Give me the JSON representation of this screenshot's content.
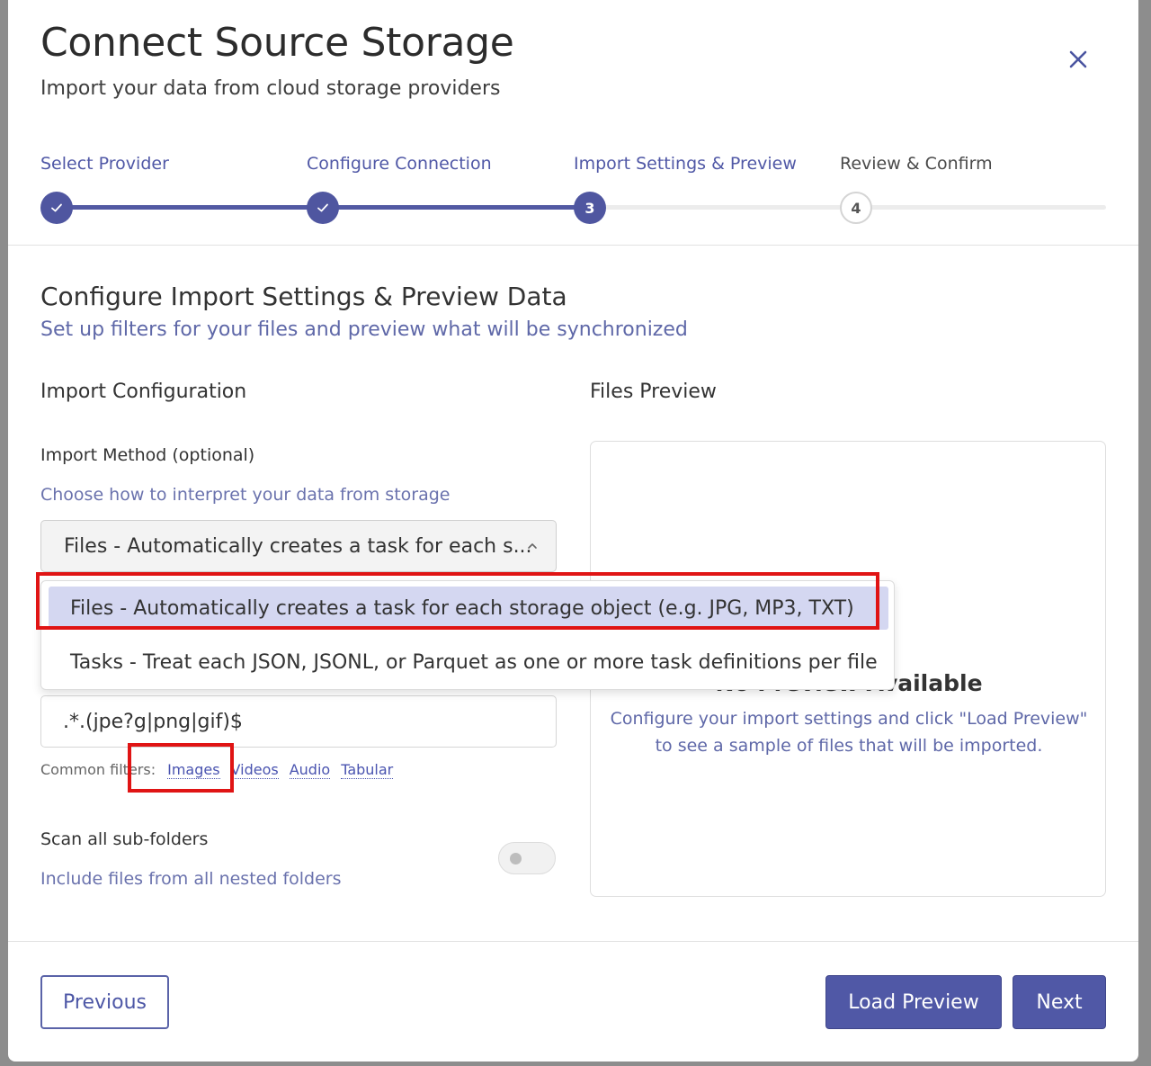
{
  "header": {
    "title": "Connect Source Storage",
    "subtitle": "Import your data from cloud storage providers"
  },
  "steps": [
    {
      "label": "Select Provider",
      "state": "done"
    },
    {
      "label": "Configure Connection",
      "state": "done"
    },
    {
      "label": "Import Settings & Preview",
      "number": "3",
      "state": "current"
    },
    {
      "label": "Review & Confirm",
      "number": "4",
      "state": "upcoming"
    }
  ],
  "section": {
    "title": "Configure Import Settings & Preview Data",
    "subtitle": "Set up filters for your files and preview what will be synchronized"
  },
  "config": {
    "heading": "Import Configuration",
    "method_label": "Import Method (optional)",
    "method_help": "Choose how to interpret your data from storage",
    "method_selected": "Files - Automatically creates a task for each s...",
    "method_options": [
      "Files - Automatically creates a task for each storage object (e.g. JPG, MP3, TXT)",
      "Tasks - Treat each JSON, JSONL, or Parquet as one or more task definitions per file"
    ],
    "regex_value": ".*.(jpe?g|png|gif)$",
    "common_filters_label": "Common filters:",
    "common_filters": [
      "Images",
      "Videos",
      "Audio",
      "Tabular"
    ],
    "scan_label": "Scan all sub-folders",
    "scan_help": "Include files from all nested folders",
    "scan_enabled": false
  },
  "preview": {
    "heading": "Files Preview",
    "empty_title": "No Preview Available",
    "empty_text_line1": "Configure your import settings and click \"Load Preview\"",
    "empty_text_line2": "to see a sample of files that will be imported."
  },
  "footer": {
    "previous": "Previous",
    "load_preview": "Load Preview",
    "next": "Next"
  },
  "colors": {
    "accent": "#5058a6",
    "highlight": "#e01414"
  }
}
